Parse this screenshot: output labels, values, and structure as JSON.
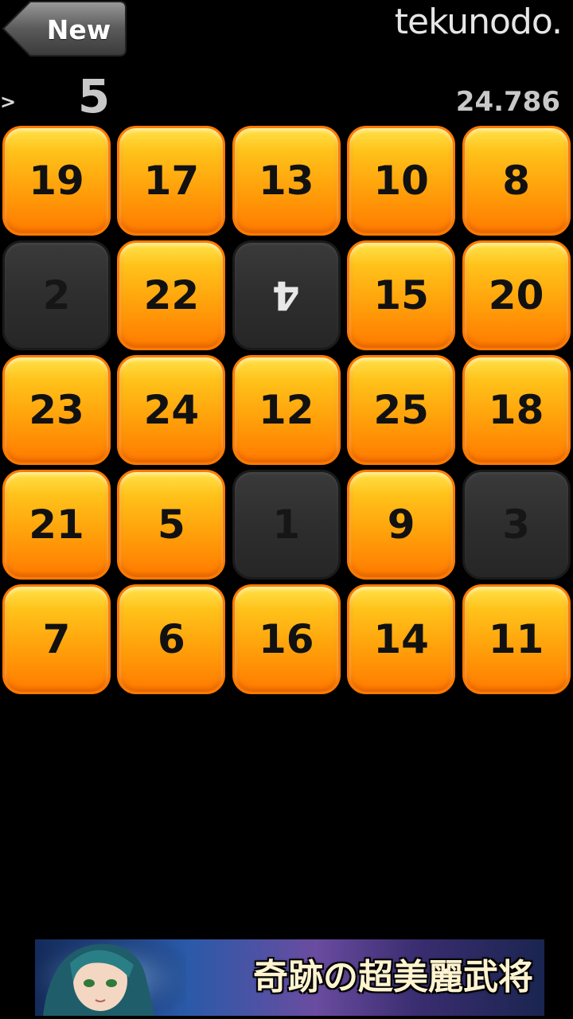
{
  "header": {
    "new_button_label": "New",
    "brand": "tekunodo.",
    "prev_marker": ">",
    "target_number": "5",
    "timer": "24.786"
  },
  "grid": {
    "tiles": [
      {
        "value": "19",
        "state": "active"
      },
      {
        "value": "17",
        "state": "active"
      },
      {
        "value": "13",
        "state": "active"
      },
      {
        "value": "10",
        "state": "active"
      },
      {
        "value": "8",
        "state": "active"
      },
      {
        "value": "2",
        "state": "done"
      },
      {
        "value": "22",
        "state": "active"
      },
      {
        "value": "4",
        "state": "done-flipped"
      },
      {
        "value": "15",
        "state": "active"
      },
      {
        "value": "20",
        "state": "active"
      },
      {
        "value": "23",
        "state": "active"
      },
      {
        "value": "24",
        "state": "active"
      },
      {
        "value": "12",
        "state": "active"
      },
      {
        "value": "25",
        "state": "active"
      },
      {
        "value": "18",
        "state": "active"
      },
      {
        "value": "21",
        "state": "active"
      },
      {
        "value": "5",
        "state": "active"
      },
      {
        "value": "1",
        "state": "done"
      },
      {
        "value": "9",
        "state": "active"
      },
      {
        "value": "3",
        "state": "done"
      },
      {
        "value": "7",
        "state": "active"
      },
      {
        "value": "6",
        "state": "active"
      },
      {
        "value": "16",
        "state": "active"
      },
      {
        "value": "14",
        "state": "active"
      },
      {
        "value": "11",
        "state": "active"
      }
    ]
  },
  "ad": {
    "text": "奇跡の超美麗武将"
  },
  "colors": {
    "tile_active": "#ff9f0a",
    "tile_done": "#2e2e2e",
    "background": "#000000"
  }
}
